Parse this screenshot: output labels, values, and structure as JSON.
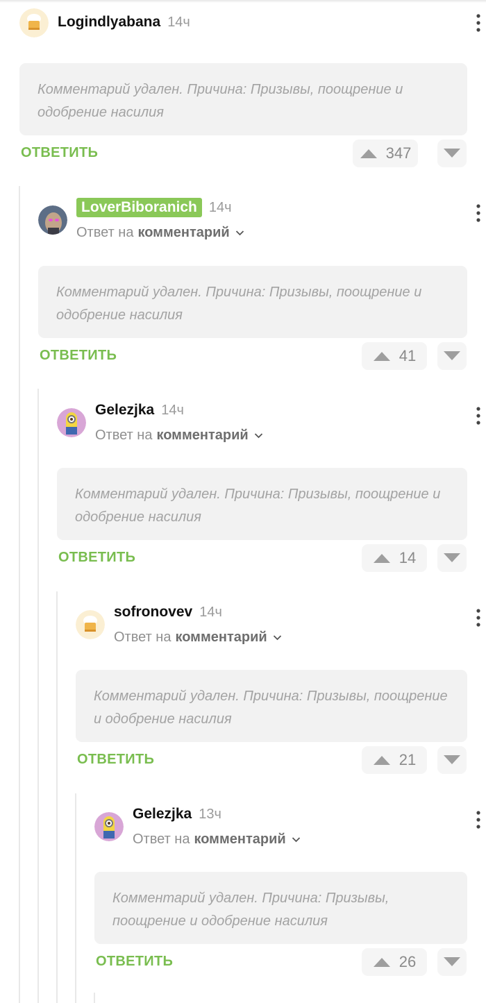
{
  "actions": {
    "reply_label": "ОТВЕТИТЬ"
  },
  "reply_to": {
    "prefix": "Ответ на",
    "link": "комментарий"
  },
  "colors": {
    "accent_green": "#79bd4f",
    "badge_green": "#8ac858",
    "body_bg": "#f2f2f2",
    "vote_bg": "#f5f5f5"
  },
  "comments": [
    {
      "author": "Logindlyabana",
      "time": "14ч",
      "avatar_icon": "chef-hat-avatar-icon",
      "text": "Комментарий удален. Причина: Призывы, поощрение и одобрение насилия",
      "votes": "347"
    },
    {
      "author": "LoverBiboranich",
      "time": "14ч",
      "avatar_icon": "glowing-eyes-portrait-avatar",
      "text": "Комментарий удален. Причина: Призывы, поощрение и одобрение насилия",
      "votes": "41"
    },
    {
      "author": "Gelezjka",
      "time": "14ч",
      "avatar_icon": "minion-avatar",
      "text": "Комментарий удален. Причина: Призывы, поощрение и одобрение насилия",
      "votes": "14"
    },
    {
      "author": "sofronovev",
      "time": "14ч",
      "avatar_icon": "chef-hat-avatar-icon",
      "text": "Комментарий удален. Причина: Призывы, поощрение и одобрение насилия",
      "votes": "21"
    },
    {
      "author": "Gelezjka",
      "time": "13ч",
      "avatar_icon": "minion-avatar",
      "text": "Комментарий удален. Причина: Призывы, поощрение и одобрение насилия",
      "votes": "26"
    }
  ]
}
